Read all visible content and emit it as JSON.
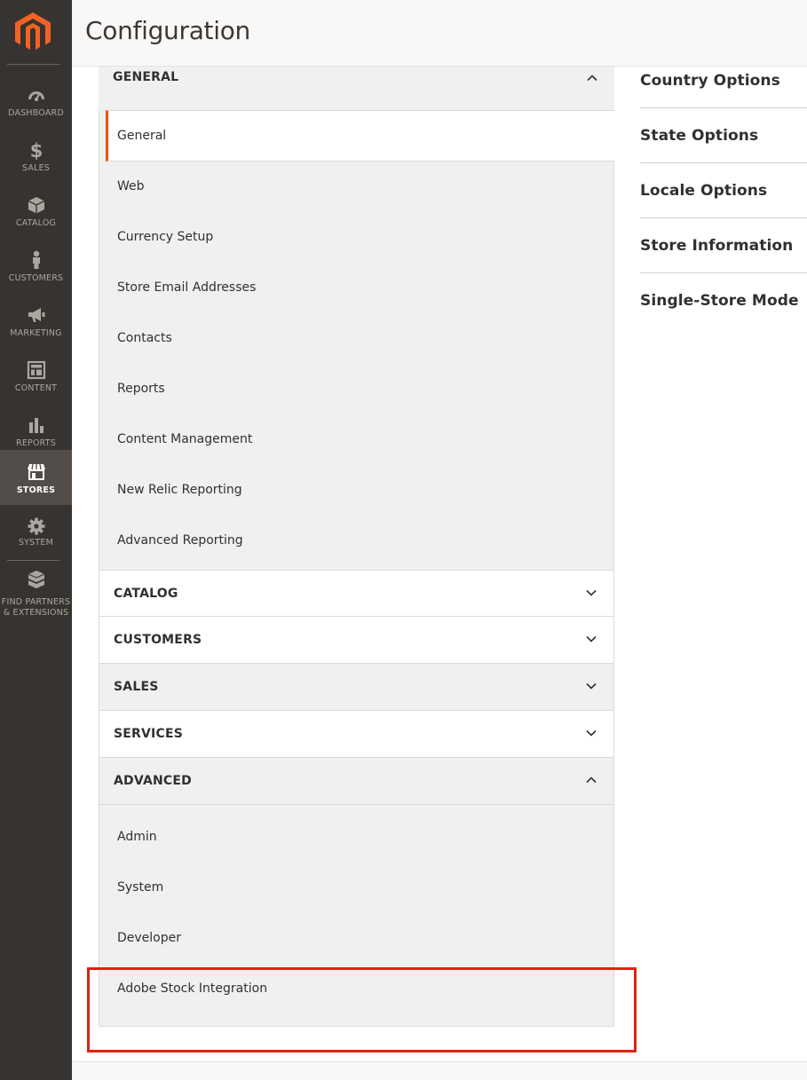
{
  "header": {
    "title": "Configuration"
  },
  "sidebar": {
    "items": [
      {
        "label": "DASHBOARD",
        "icon": "dashboard-icon"
      },
      {
        "label": "SALES",
        "icon": "dollar-icon"
      },
      {
        "label": "CATALOG",
        "icon": "box-icon"
      },
      {
        "label": "CUSTOMERS",
        "icon": "person-icon"
      },
      {
        "label": "MARKETING",
        "icon": "megaphone-icon"
      },
      {
        "label": "CONTENT",
        "icon": "layout-icon"
      },
      {
        "label": "REPORTS",
        "icon": "bar-chart-icon"
      },
      {
        "label": "STORES",
        "icon": "store-icon",
        "active": true
      },
      {
        "label": "SYSTEM",
        "icon": "gear-icon"
      },
      {
        "label_line1": "FIND PARTNERS",
        "label_line2": "& EXTENSIONS",
        "icon": "blocks-icon"
      }
    ]
  },
  "config": {
    "general": {
      "title": "GENERAL",
      "items": [
        "General",
        "Web",
        "Currency Setup",
        "Store Email Addresses",
        "Contacts",
        "Reports",
        "Content Management",
        "New Relic Reporting",
        "Advanced Reporting"
      ]
    },
    "catalog": {
      "title": "CATALOG"
    },
    "customers": {
      "title": "CUSTOMERS"
    },
    "sales": {
      "title": "SALES"
    },
    "services": {
      "title": "SERVICES"
    },
    "advanced": {
      "title": "ADVANCED",
      "items": [
        "Admin",
        "System",
        "Developer",
        "Adobe Stock Integration"
      ]
    }
  },
  "options": [
    "Country Options",
    "State Options",
    "Locale Options",
    "Store Information",
    "Single-Store Mode"
  ],
  "colors": {
    "accent": "#eb5202",
    "sidebar": "#373330",
    "highlight": "#e5200e"
  }
}
